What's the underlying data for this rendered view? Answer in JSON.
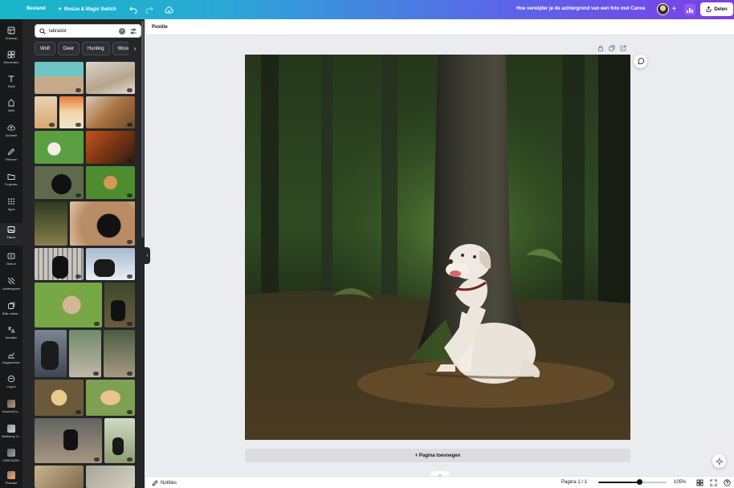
{
  "topbar": {
    "file_label": "Bestand",
    "resize_label": "Resize & Magic Switch",
    "doc_title": "Hoe verwijder je de achtergrond van een foto met Canva",
    "share_label": "Delen",
    "icons": [
      "undo-icon",
      "redo-icon",
      "cloud-saved-icon",
      "plus-icon",
      "stats-icon",
      "share-icon"
    ]
  },
  "rail": {
    "items": [
      {
        "label": "Ontwerp",
        "icon": "layout-icon"
      },
      {
        "label": "Elementen",
        "icon": "shapes-icon"
      },
      {
        "label": "Tekst",
        "icon": "text-icon"
      },
      {
        "label": "Merk",
        "icon": "brand-icon"
      },
      {
        "label": "Uploads",
        "icon": "upload-icon"
      },
      {
        "label": "Tekenen",
        "icon": "draw-icon"
      },
      {
        "label": "Projecten",
        "icon": "folder-icon"
      },
      {
        "label": "Apps",
        "icon": "apps-icon"
      },
      {
        "label": "Foto's",
        "icon": "photo-icon"
      },
      {
        "label": "Video's",
        "icon": "video-icon"
      },
      {
        "label": "Achtergrond",
        "icon": "background-icon"
      },
      {
        "label": "Bulk ontwe...",
        "icon": "bulk-icon"
      },
      {
        "label": "Vertalen",
        "icon": "translate-icon"
      },
      {
        "label": "Diagrammen",
        "icon": "chart-icon"
      },
      {
        "label": "Logo's",
        "icon": "logo-icon"
      },
      {
        "label": "Kaartvrij fo...",
        "icon": "thumbnail-icon"
      },
      {
        "label": "Webshop S...",
        "icon": "thumbnail-icon"
      },
      {
        "label": "CAROUSEL",
        "icon": "thumbnail-icon"
      },
      {
        "label": "Podcast",
        "icon": "thumbnail-icon"
      }
    ],
    "active_index": 8
  },
  "panel": {
    "search_value": "labrador",
    "chips": [
      "Wolf",
      "Deer",
      "Hunting",
      "Woods"
    ]
  },
  "toolbar": {
    "position_label": "Positie"
  },
  "canvas": {
    "add_page_label": "+ Pagina toevoegen"
  },
  "footer": {
    "notes_label": "Notities",
    "page_label": "Pagina 1 / 1",
    "zoom_label": "105%",
    "zoom_fraction": 0.6
  },
  "colors": {
    "accent": "#7c3fe6",
    "panel_bg": "#252627",
    "rail_bg": "#18191b"
  }
}
